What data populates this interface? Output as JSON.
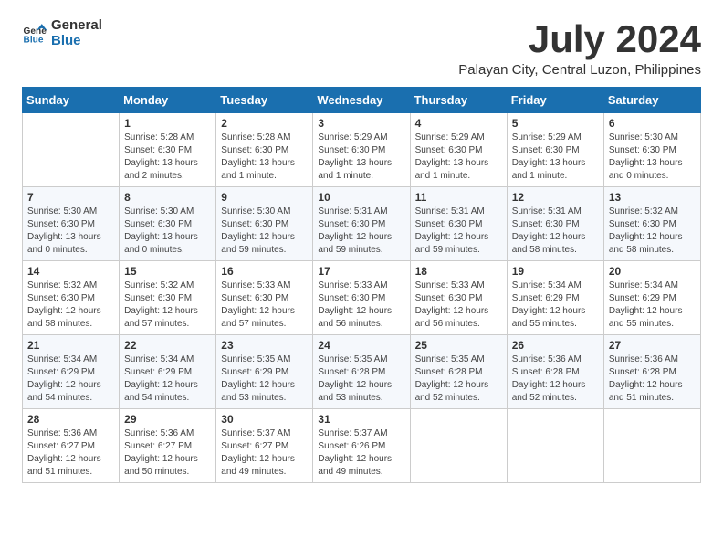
{
  "header": {
    "logo_general": "General",
    "logo_blue": "Blue",
    "title": "July 2024",
    "subtitle": "Palayan City, Central Luzon, Philippines"
  },
  "calendar": {
    "days_of_week": [
      "Sunday",
      "Monday",
      "Tuesday",
      "Wednesday",
      "Thursday",
      "Friday",
      "Saturday"
    ],
    "weeks": [
      [
        {
          "day": "",
          "info": ""
        },
        {
          "day": "1",
          "info": "Sunrise: 5:28 AM\nSunset: 6:30 PM\nDaylight: 13 hours\nand 2 minutes."
        },
        {
          "day": "2",
          "info": "Sunrise: 5:28 AM\nSunset: 6:30 PM\nDaylight: 13 hours\nand 1 minute."
        },
        {
          "day": "3",
          "info": "Sunrise: 5:29 AM\nSunset: 6:30 PM\nDaylight: 13 hours\nand 1 minute."
        },
        {
          "day": "4",
          "info": "Sunrise: 5:29 AM\nSunset: 6:30 PM\nDaylight: 13 hours\nand 1 minute."
        },
        {
          "day": "5",
          "info": "Sunrise: 5:29 AM\nSunset: 6:30 PM\nDaylight: 13 hours\nand 1 minute."
        },
        {
          "day": "6",
          "info": "Sunrise: 5:30 AM\nSunset: 6:30 PM\nDaylight: 13 hours\nand 0 minutes."
        }
      ],
      [
        {
          "day": "7",
          "info": "Sunrise: 5:30 AM\nSunset: 6:30 PM\nDaylight: 13 hours\nand 0 minutes."
        },
        {
          "day": "8",
          "info": "Sunrise: 5:30 AM\nSunset: 6:30 PM\nDaylight: 13 hours\nand 0 minutes."
        },
        {
          "day": "9",
          "info": "Sunrise: 5:30 AM\nSunset: 6:30 PM\nDaylight: 12 hours\nand 59 minutes."
        },
        {
          "day": "10",
          "info": "Sunrise: 5:31 AM\nSunset: 6:30 PM\nDaylight: 12 hours\nand 59 minutes."
        },
        {
          "day": "11",
          "info": "Sunrise: 5:31 AM\nSunset: 6:30 PM\nDaylight: 12 hours\nand 59 minutes."
        },
        {
          "day": "12",
          "info": "Sunrise: 5:31 AM\nSunset: 6:30 PM\nDaylight: 12 hours\nand 58 minutes."
        },
        {
          "day": "13",
          "info": "Sunrise: 5:32 AM\nSunset: 6:30 PM\nDaylight: 12 hours\nand 58 minutes."
        }
      ],
      [
        {
          "day": "14",
          "info": "Sunrise: 5:32 AM\nSunset: 6:30 PM\nDaylight: 12 hours\nand 58 minutes."
        },
        {
          "day": "15",
          "info": "Sunrise: 5:32 AM\nSunset: 6:30 PM\nDaylight: 12 hours\nand 57 minutes."
        },
        {
          "day": "16",
          "info": "Sunrise: 5:33 AM\nSunset: 6:30 PM\nDaylight: 12 hours\nand 57 minutes."
        },
        {
          "day": "17",
          "info": "Sunrise: 5:33 AM\nSunset: 6:30 PM\nDaylight: 12 hours\nand 56 minutes."
        },
        {
          "day": "18",
          "info": "Sunrise: 5:33 AM\nSunset: 6:30 PM\nDaylight: 12 hours\nand 56 minutes."
        },
        {
          "day": "19",
          "info": "Sunrise: 5:34 AM\nSunset: 6:29 PM\nDaylight: 12 hours\nand 55 minutes."
        },
        {
          "day": "20",
          "info": "Sunrise: 5:34 AM\nSunset: 6:29 PM\nDaylight: 12 hours\nand 55 minutes."
        }
      ],
      [
        {
          "day": "21",
          "info": "Sunrise: 5:34 AM\nSunset: 6:29 PM\nDaylight: 12 hours\nand 54 minutes."
        },
        {
          "day": "22",
          "info": "Sunrise: 5:34 AM\nSunset: 6:29 PM\nDaylight: 12 hours\nand 54 minutes."
        },
        {
          "day": "23",
          "info": "Sunrise: 5:35 AM\nSunset: 6:29 PM\nDaylight: 12 hours\nand 53 minutes."
        },
        {
          "day": "24",
          "info": "Sunrise: 5:35 AM\nSunset: 6:28 PM\nDaylight: 12 hours\nand 53 minutes."
        },
        {
          "day": "25",
          "info": "Sunrise: 5:35 AM\nSunset: 6:28 PM\nDaylight: 12 hours\nand 52 minutes."
        },
        {
          "day": "26",
          "info": "Sunrise: 5:36 AM\nSunset: 6:28 PM\nDaylight: 12 hours\nand 52 minutes."
        },
        {
          "day": "27",
          "info": "Sunrise: 5:36 AM\nSunset: 6:28 PM\nDaylight: 12 hours\nand 51 minutes."
        }
      ],
      [
        {
          "day": "28",
          "info": "Sunrise: 5:36 AM\nSunset: 6:27 PM\nDaylight: 12 hours\nand 51 minutes."
        },
        {
          "day": "29",
          "info": "Sunrise: 5:36 AM\nSunset: 6:27 PM\nDaylight: 12 hours\nand 50 minutes."
        },
        {
          "day": "30",
          "info": "Sunrise: 5:37 AM\nSunset: 6:27 PM\nDaylight: 12 hours\nand 49 minutes."
        },
        {
          "day": "31",
          "info": "Sunrise: 5:37 AM\nSunset: 6:26 PM\nDaylight: 12 hours\nand 49 minutes."
        },
        {
          "day": "",
          "info": ""
        },
        {
          "day": "",
          "info": ""
        },
        {
          "day": "",
          "info": ""
        }
      ]
    ]
  }
}
